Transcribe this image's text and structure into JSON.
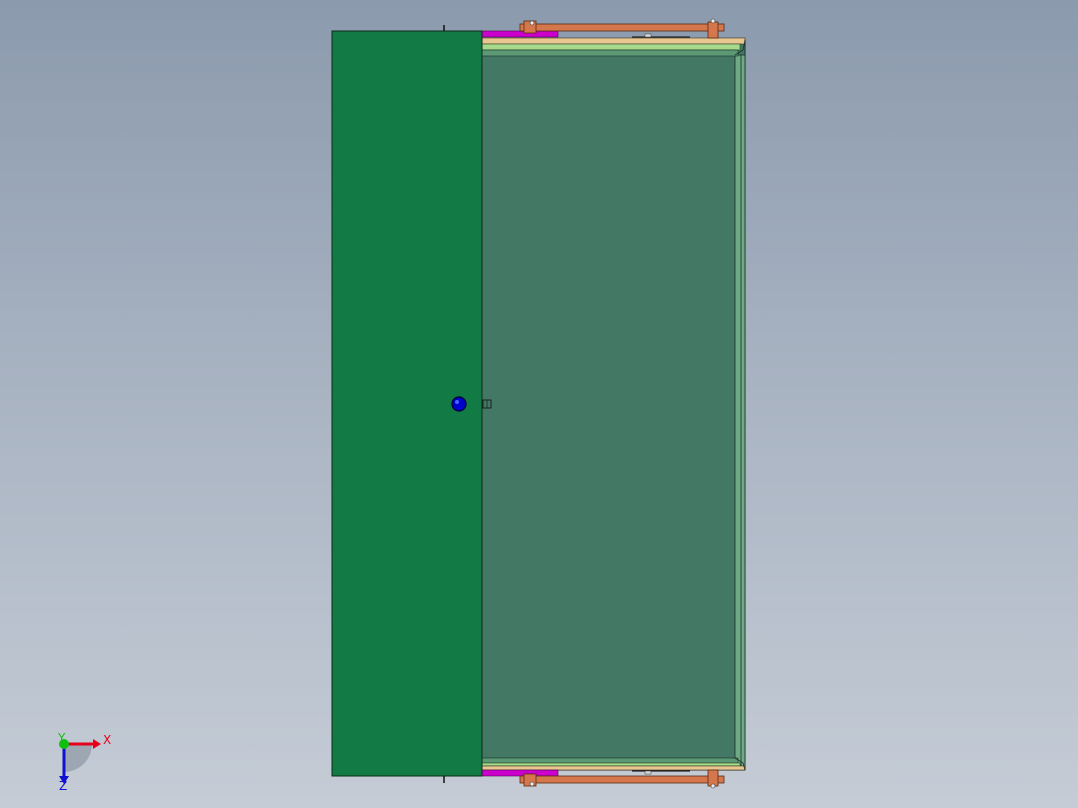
{
  "viewport": {
    "background_top": "#8b9aad",
    "background_bottom": "#c5ccd6"
  },
  "model": {
    "front_panel_color": "#127a44",
    "inner_panel_color": "#437865",
    "rail_color": "#d4774d",
    "magenta_strip_color": "#cc00cc",
    "origin_marker_color": "#0000cc"
  },
  "triad": {
    "x_label": "X",
    "y_label": "Y",
    "z_label": "Z",
    "x_color": "#e8001a",
    "y_color": "#10c010",
    "z_color": "#1010d0"
  }
}
